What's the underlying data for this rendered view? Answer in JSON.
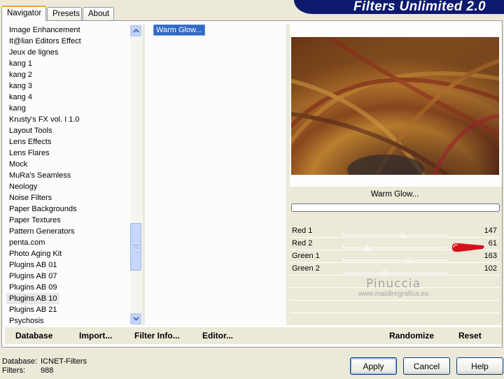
{
  "header": {
    "title": "Filters Unlimited 2.0"
  },
  "tabs": [
    {
      "label": "Navigator",
      "active": true
    },
    {
      "label": "Presets",
      "active": false
    },
    {
      "label": "About",
      "active": false
    }
  ],
  "categories": {
    "items": [
      "Image Enhancement",
      "It@lian Editors Effect",
      "Jeux de lignes",
      "kang 1",
      "kang 2",
      "kang 3",
      "kang 4",
      "kang",
      "Krusty's FX vol. I 1.0",
      "Layout Tools",
      "Lens Effects",
      "Lens Flares",
      "Mock",
      "MuRa's Seamless",
      "Neology",
      "Noise Filters",
      "Paper Backgrounds",
      "Paper Textures",
      "Pattern Generators",
      "penta.com",
      "Photo Aging Kit",
      "Plugins AB 01",
      "Plugins AB 07",
      "Plugins AB 09",
      "Plugins AB 10",
      "Plugins AB 21",
      "Psychosis"
    ],
    "selected": "Plugins AB 10"
  },
  "filters": {
    "items": [
      "Warm Glow..."
    ],
    "selected": "Warm Glow..."
  },
  "preview": {
    "filter_name": "Warm Glow..."
  },
  "params": [
    {
      "label": "Red 1",
      "value": "147",
      "level": 147
    },
    {
      "label": "Red 2",
      "value": "61",
      "level": 61
    },
    {
      "label": "Green 1",
      "value": "163",
      "level": 163
    },
    {
      "label": "Green 2",
      "value": "102",
      "level": 102
    }
  ],
  "watermark": {
    "name": "Pinuccia",
    "url": "www.maidiregrafica.eu"
  },
  "signature": {
    "text": "pinuccia"
  },
  "actions": {
    "database": "Database",
    "import": "Import...",
    "filter_info": "Filter Info...",
    "editor": "Editor...",
    "randomize": "Randomize",
    "reset": "Reset"
  },
  "footer": {
    "database_label": "Database:",
    "database_value": "ICNET-Filters",
    "filters_label": "Filters:",
    "filters_value": "988"
  },
  "buttons": {
    "apply": "Apply",
    "cancel": "Cancel",
    "help": "Help"
  },
  "colors": {
    "selection": "#316ac5",
    "banner": "#0d1a6e",
    "tab_accent": "#f6a033"
  }
}
